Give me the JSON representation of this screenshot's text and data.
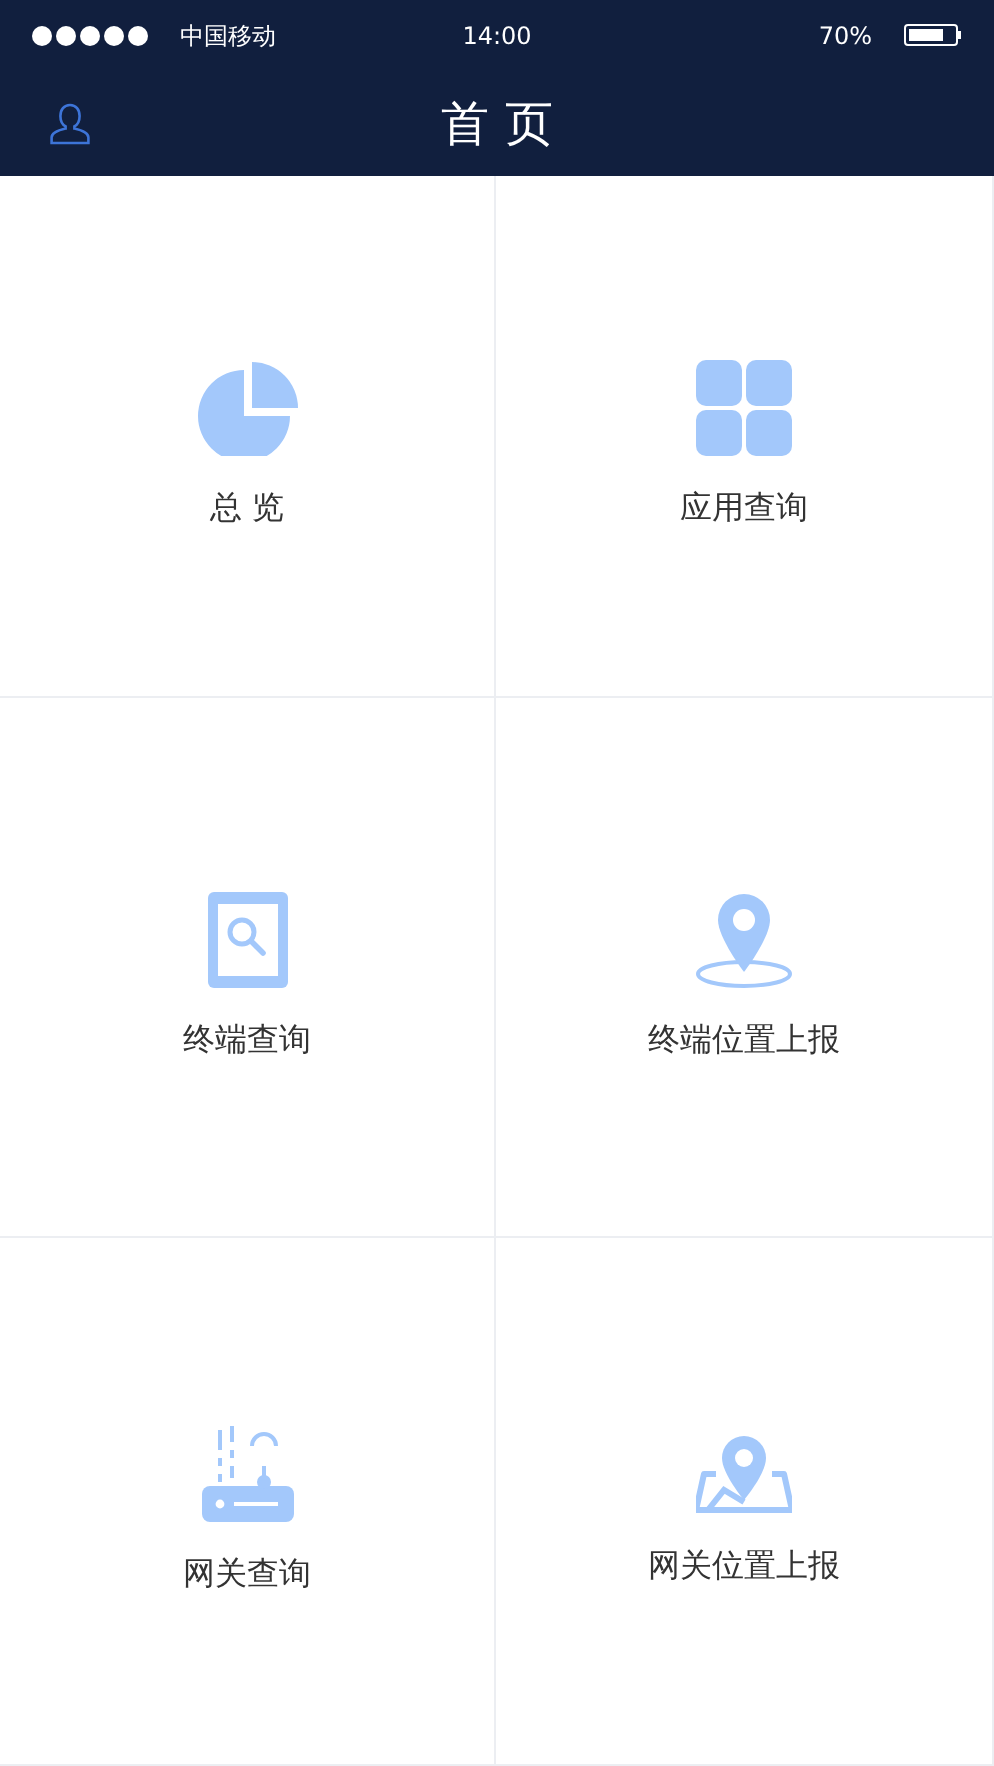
{
  "status_bar": {
    "carrier": "中国移动",
    "time": "14:00",
    "battery": "70%"
  },
  "header": {
    "title": "首 页"
  },
  "tiles": [
    {
      "kind": "pie",
      "label": "总 览"
    },
    {
      "kind": "apps",
      "label": "应用查询"
    },
    {
      "kind": "tablet-search",
      "label": "终端查询"
    },
    {
      "kind": "pin",
      "label": "终端位置上报"
    },
    {
      "kind": "router",
      "label": "网关查询"
    },
    {
      "kind": "map-pin",
      "label": "网关位置上报"
    }
  ]
}
